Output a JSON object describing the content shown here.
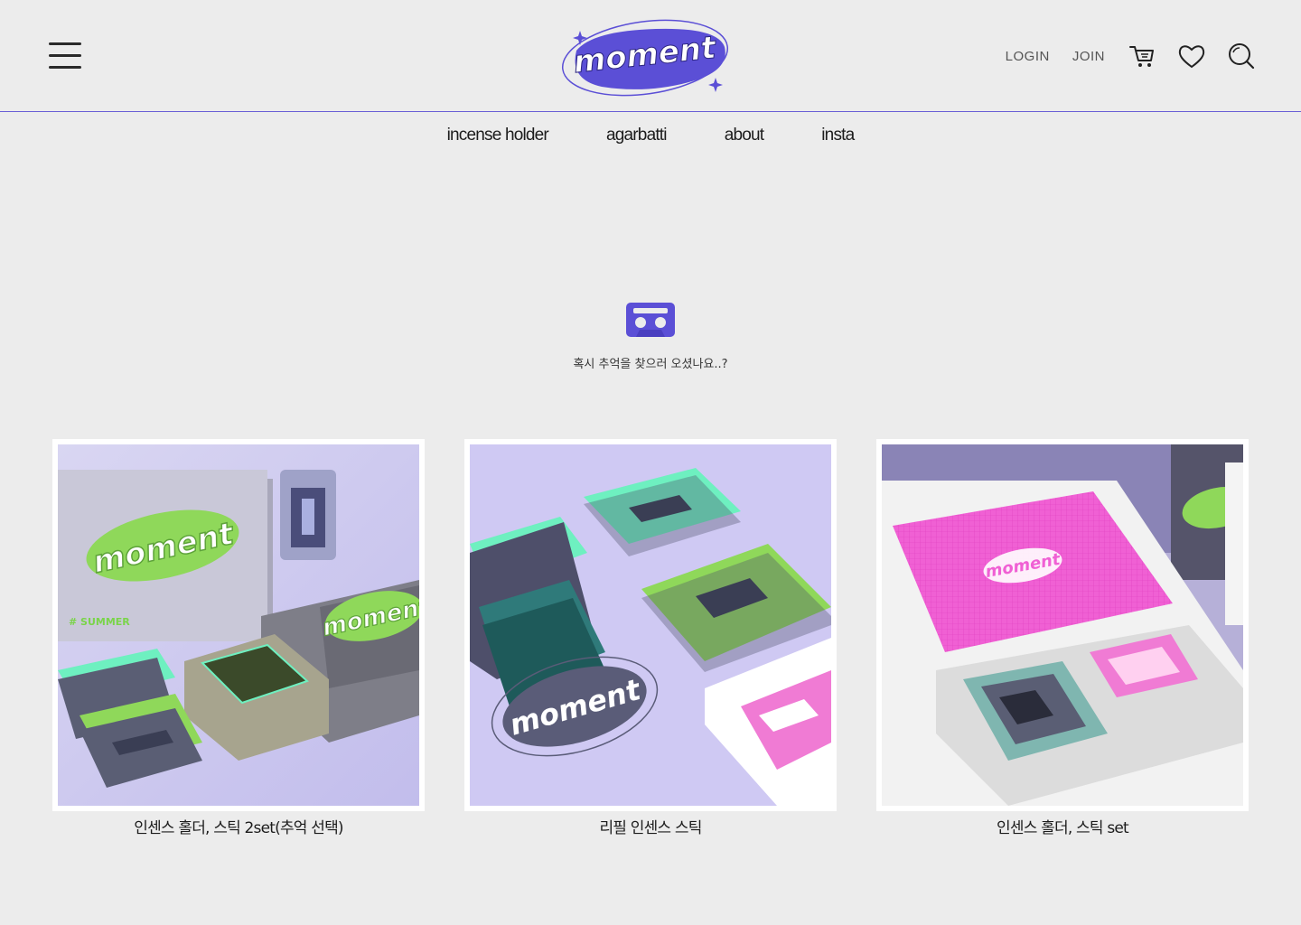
{
  "header": {
    "logo_text": "moment",
    "login_label": "LOGIN",
    "join_label": "JOIN"
  },
  "nav": {
    "items": [
      {
        "label": "incense holder"
      },
      {
        "label": "agarbatti"
      },
      {
        "label": "about"
      },
      {
        "label": "insta"
      }
    ]
  },
  "hero": {
    "icon": "cassette-icon",
    "text": "혹시 추억을 찾으러 오셨나요..?"
  },
  "products": [
    {
      "name": "인센스 홀더, 스틱 2set(추억 선택)"
    },
    {
      "name": "리필 인센스 스틱"
    },
    {
      "name": "인센스 홀더, 스틱 set"
    }
  ],
  "colors": {
    "accent": "#5b4fd6",
    "background": "#ececec",
    "mint": "#6ef0c0",
    "green": "#8fd85a",
    "pink": "#f070d8"
  }
}
